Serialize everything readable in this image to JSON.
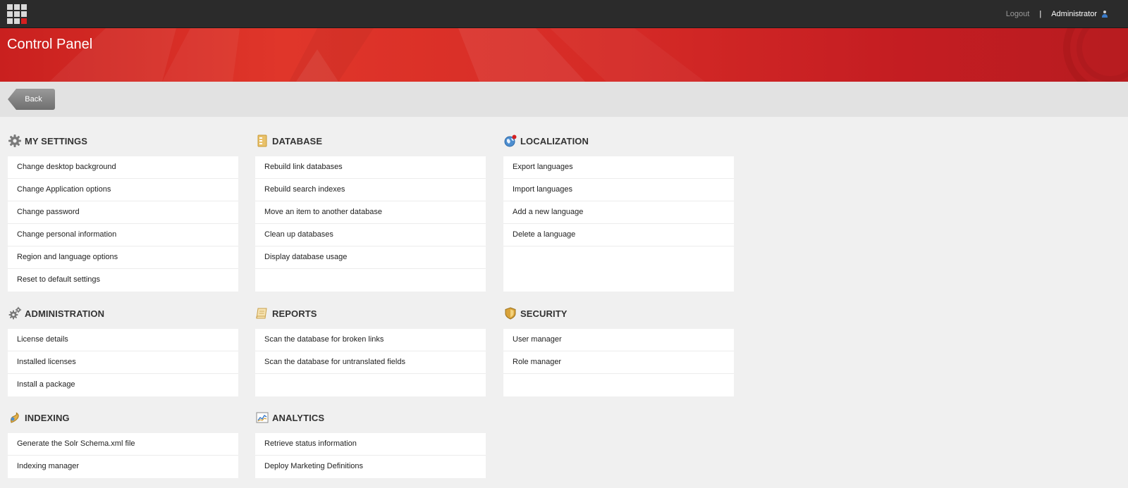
{
  "topbar": {
    "logout_label": "Logout",
    "separator": "|",
    "user_name": "Administrator"
  },
  "header": {
    "title": "Control Panel"
  },
  "backbar": {
    "back_label": "Back"
  },
  "sections": {
    "my_settings": {
      "title": "MY SETTINGS",
      "icon": "gear-icon",
      "items": [
        "Change desktop background",
        "Change Application options",
        "Change password",
        "Change personal information",
        "Region and language options",
        "Reset to default settings"
      ]
    },
    "database": {
      "title": "DATABASE",
      "icon": "database-icon",
      "items": [
        "Rebuild link databases",
        "Rebuild search indexes",
        "Move an item to another database",
        "Clean up databases",
        "Display database usage"
      ]
    },
    "localization": {
      "title": "LOCALIZATION",
      "icon": "globe-icon",
      "items": [
        "Export languages",
        "Import languages",
        "Add a new language",
        "Delete a language"
      ]
    },
    "administration": {
      "title": "ADMINISTRATION",
      "icon": "gears-icon",
      "items": [
        "License details",
        "Installed licenses",
        "Install a package"
      ]
    },
    "reports": {
      "title": "REPORTS",
      "icon": "scroll-icon",
      "items": [
        "Scan the database for broken links",
        "Scan the database for untranslated fields"
      ]
    },
    "security": {
      "title": "SECURITY",
      "icon": "shield-icon",
      "items": [
        "User manager",
        "Role manager"
      ]
    },
    "indexing": {
      "title": "INDEXING",
      "icon": "indexing-icon",
      "items": [
        "Generate the Solr Schema.xml file",
        "Indexing manager"
      ]
    },
    "analytics": {
      "title": "ANALYTICS",
      "icon": "chart-icon",
      "items": [
        "Retrieve status information",
        "Deploy Marketing Definitions"
      ]
    }
  },
  "colors": {
    "topbar_bg": "#2b2b2b",
    "banner_red": "#d52a26",
    "page_bg": "#f0f0f0",
    "backbar_bg": "#e2e2e2"
  }
}
